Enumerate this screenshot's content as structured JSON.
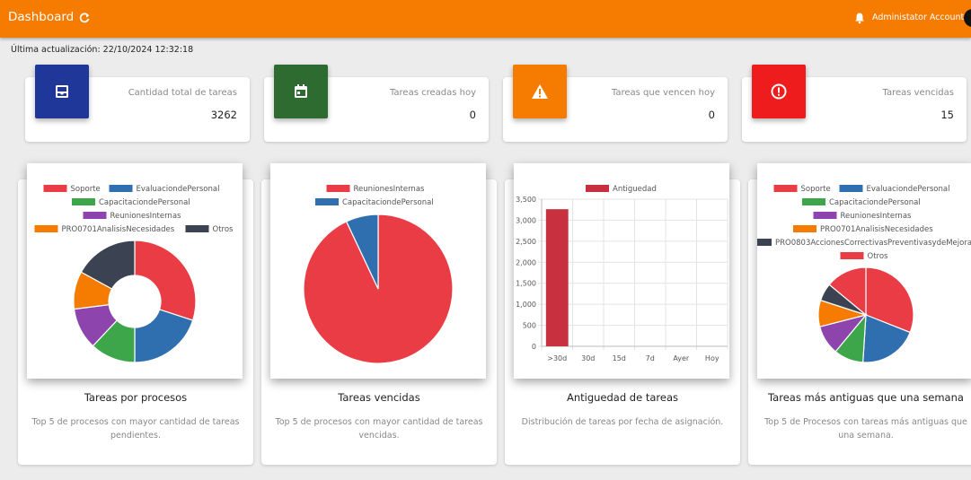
{
  "topbar": {
    "title": "Dashboard",
    "account": "Administator Account"
  },
  "updated": "Última actualización: 22/10/2024 12:32:18",
  "stats": [
    {
      "label": "Cantidad total de tareas",
      "value": "3262",
      "color": "#1e3799",
      "icon": "inbox-tray-icon"
    },
    {
      "label": "Tareas creadas hoy",
      "value": "0",
      "color": "#2e6b30",
      "icon": "calendar-icon"
    },
    {
      "label": "Tareas que vencen hoy",
      "value": "0",
      "color": "#f57c00",
      "icon": "warning-icon"
    },
    {
      "label": "Tareas vencidas",
      "value": "15",
      "color": "#ee1c1c",
      "icon": "alert-circle-icon"
    }
  ],
  "panels": [
    {
      "title": "Tareas por procesos",
      "desc": "Top 5 de procesos con mayor cantidad de tareas pendientes."
    },
    {
      "title": "Tareas vencidas",
      "desc": "Top 5 de procesos con mayor cantidad de tareas vencidas."
    },
    {
      "title": "Antiguedad de tareas",
      "desc": "Distribución de tareas por fecha de asignación."
    },
    {
      "title": "Tareas más antiguas que una semana",
      "desc": "Top 5 de Procesos con tareas más antiguas que una semana."
    }
  ],
  "chart_data": [
    {
      "type": "pie",
      "subtype": "doughnut",
      "legend_placement": "top",
      "categories": [
        "Soporte",
        "EvaluaciondePersonal",
        "CapacitaciondePersonal",
        "ReunionesInternas",
        "PRO0701AnalisisNecesidades",
        "Otros"
      ],
      "values": [
        30,
        20,
        12,
        11,
        10,
        17
      ],
      "colors": [
        "#ea3c44",
        "#2f6fb0",
        "#3ea64a",
        "#8e44ad",
        "#f57c00",
        "#3b4252"
      ]
    },
    {
      "type": "pie",
      "legend_placement": "top",
      "categories": [
        "ReunionesInternas",
        "CapacitaciondePersonal"
      ],
      "values": [
        93,
        7
      ],
      "colors": [
        "#ea3c44",
        "#2f6fb0"
      ]
    },
    {
      "type": "bar",
      "legend_placement": "top",
      "series": [
        {
          "name": "Antiguedad",
          "values": [
            3262,
            0,
            0,
            0,
            0,
            0
          ]
        }
      ],
      "categories": [
        ">30d",
        "30d",
        "15d",
        "7d",
        "Ayer",
        "Hoy"
      ],
      "ylim": [
        0,
        3500
      ],
      "yticks": [
        "0",
        "500",
        "1,000",
        "1,500",
        "2,000",
        "2,500",
        "3,000",
        "3,500"
      ],
      "grid": true,
      "color": "#c8303f"
    },
    {
      "type": "pie",
      "legend_placement": "top",
      "categories": [
        "Soporte",
        "EvaluaciondePersonal",
        "CapacitaciondePersonal",
        "ReunionesInternas",
        "PRO0701AnalisisNecesidades",
        "PRO0803AccionesCorrectivasPreventivasydeMejora",
        "Otros"
      ],
      "values": [
        31,
        20,
        10,
        10,
        9,
        6,
        14
      ],
      "colors": [
        "#ea3c44",
        "#2f6fb0",
        "#3ea64a",
        "#8e44ad",
        "#f57c00",
        "#3b4252",
        "#ea3c44"
      ]
    }
  ]
}
